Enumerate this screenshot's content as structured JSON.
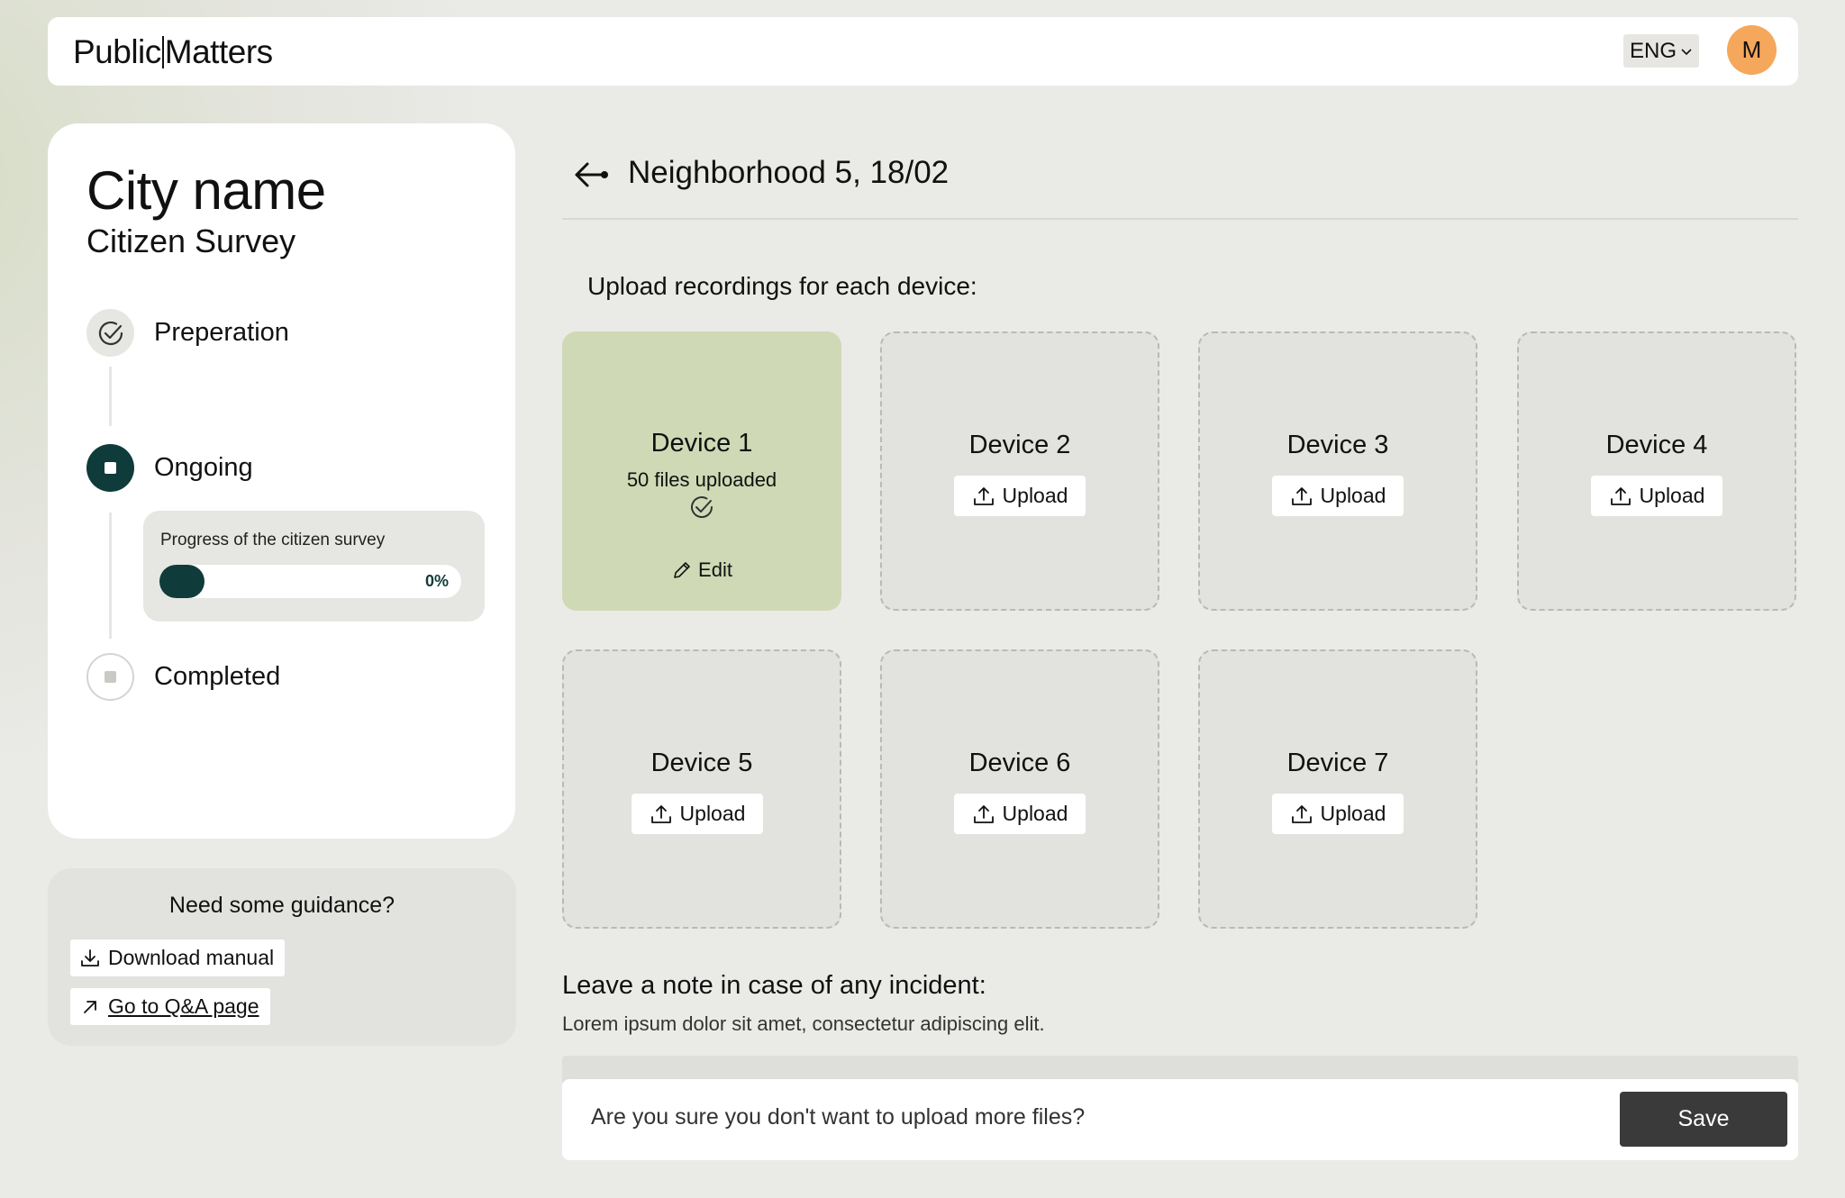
{
  "header": {
    "logo_part1": "Public",
    "logo_part2": "Matters",
    "language": "ENG",
    "avatar_initial": "M"
  },
  "sidebar": {
    "city_name": "City name",
    "survey_name": "Citizen Survey",
    "steps": [
      {
        "label": "Preperation",
        "state": "done"
      },
      {
        "label": "Ongoing",
        "state": "active"
      },
      {
        "label": "Completed",
        "state": "todo"
      }
    ],
    "progress": {
      "title": "Progress of the citizen survey",
      "value_percent": 0,
      "label": "0%"
    }
  },
  "guidance": {
    "title": "Need some guidance?",
    "download_label": "Download manual",
    "qa_label": "Go to Q&A page"
  },
  "main": {
    "title": "Neighborhood 5, 18/02",
    "upload_prompt": "Upload recordings for each device:",
    "devices": [
      {
        "name": "Device 1",
        "status": "uploaded",
        "files": "50 files uploaded",
        "action": "Edit"
      },
      {
        "name": "Device 2",
        "status": "empty",
        "action": "Upload"
      },
      {
        "name": "Device 3",
        "status": "empty",
        "action": "Upload"
      },
      {
        "name": "Device 4",
        "status": "empty",
        "action": "Upload"
      },
      {
        "name": "Device 5",
        "status": "empty",
        "action": "Upload"
      },
      {
        "name": "Device 6",
        "status": "empty",
        "action": "Upload"
      },
      {
        "name": "Device 7",
        "status": "empty",
        "action": "Upload"
      }
    ],
    "note_title": "Leave a note in case of any incident:",
    "note_desc": "Lorem ipsum dolor sit amet, consectetur adipiscing elit.",
    "note_input": "Are you sure you don't want to upload more files?",
    "save_label": "Save"
  },
  "colors": {
    "accent_dark": "#0f3b3a",
    "uploaded_card": "#cfd9b5",
    "avatar": "#f5a75b",
    "save_button": "#3a3a3a"
  }
}
